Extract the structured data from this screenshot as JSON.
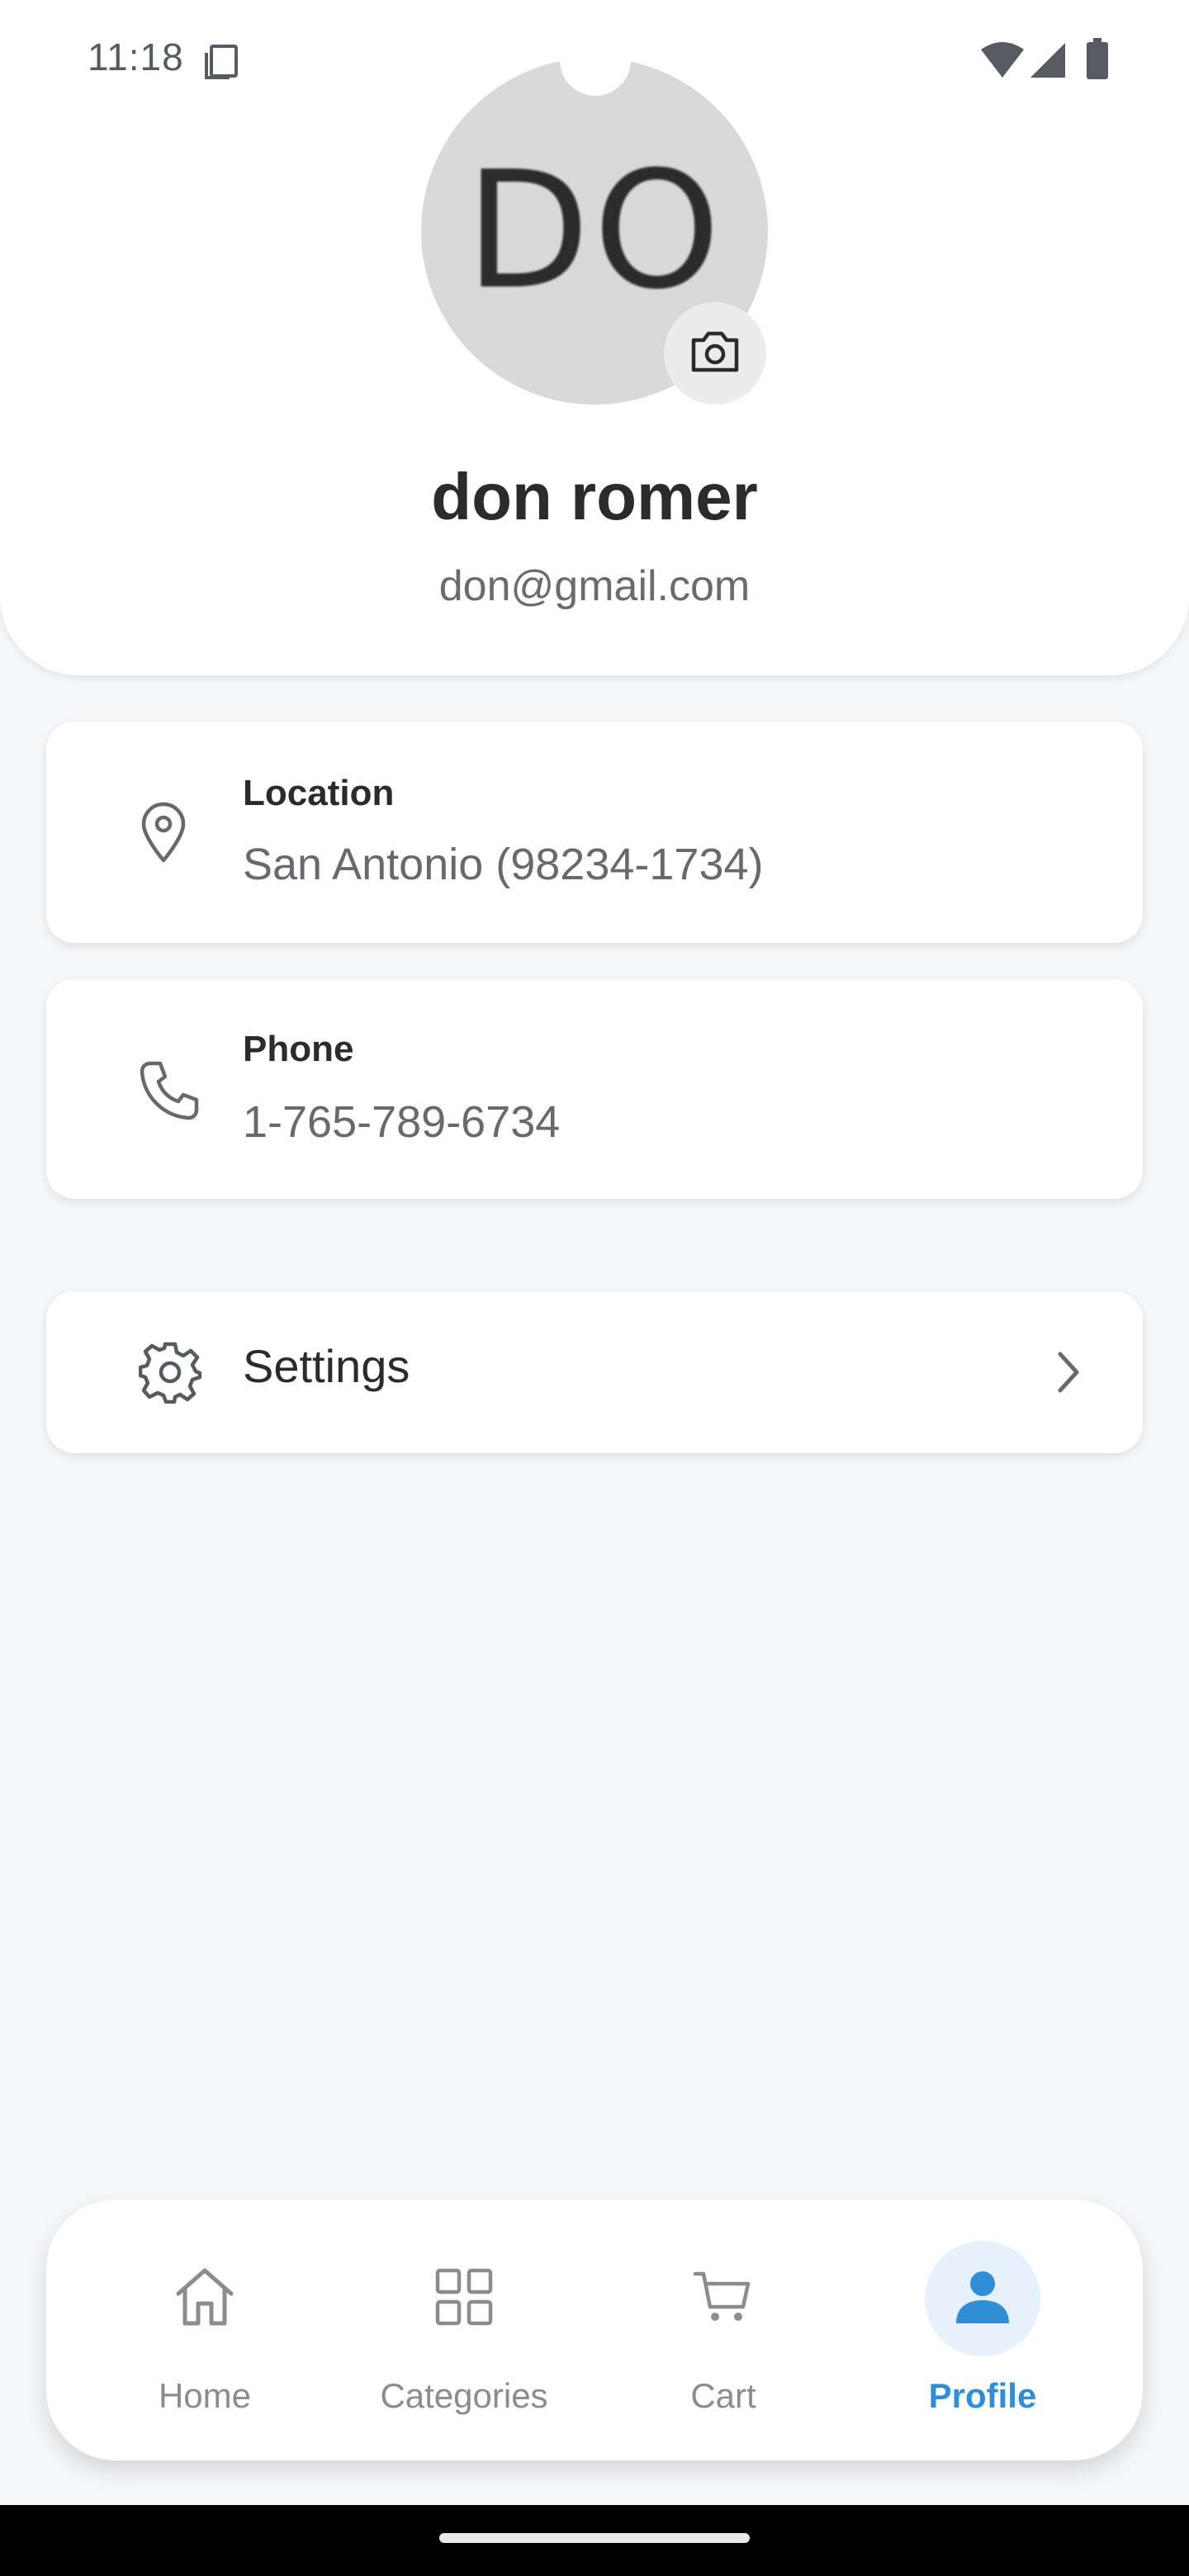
{
  "status_bar": {
    "time": "11:18",
    "icons": [
      "screen-icon",
      "wifi-icon",
      "signal-icon",
      "battery-icon"
    ]
  },
  "profile": {
    "initials": "DO",
    "name": "don romer",
    "email": "don@gmail.com",
    "avatar_color": "#d9d9d9"
  },
  "info_cards": [
    {
      "icon": "location-pin-icon",
      "label": "Location",
      "value": "San Antonio (98234-1734)"
    },
    {
      "icon": "phone-icon",
      "label": "Phone",
      "value": "1-765-789-6734"
    }
  ],
  "settings": {
    "icon": "gear-icon",
    "label": "Settings"
  },
  "bottom_nav": {
    "items": [
      {
        "icon": "home-icon",
        "label": "Home",
        "active": false
      },
      {
        "icon": "categories-grid-icon",
        "label": "Categories",
        "active": false
      },
      {
        "icon": "cart-icon",
        "label": "Cart",
        "active": false
      },
      {
        "icon": "profile-person-icon",
        "label": "Profile",
        "active": true
      }
    ]
  },
  "colors": {
    "accent": "#2f8fd6",
    "accent_light": "#e6f1fb",
    "background": "#f6f7f9",
    "card": "#ffffff",
    "text_primary": "#2b2b2b",
    "text_secondary": "#6b6b6b",
    "icon_muted": "#8c8c8c"
  }
}
